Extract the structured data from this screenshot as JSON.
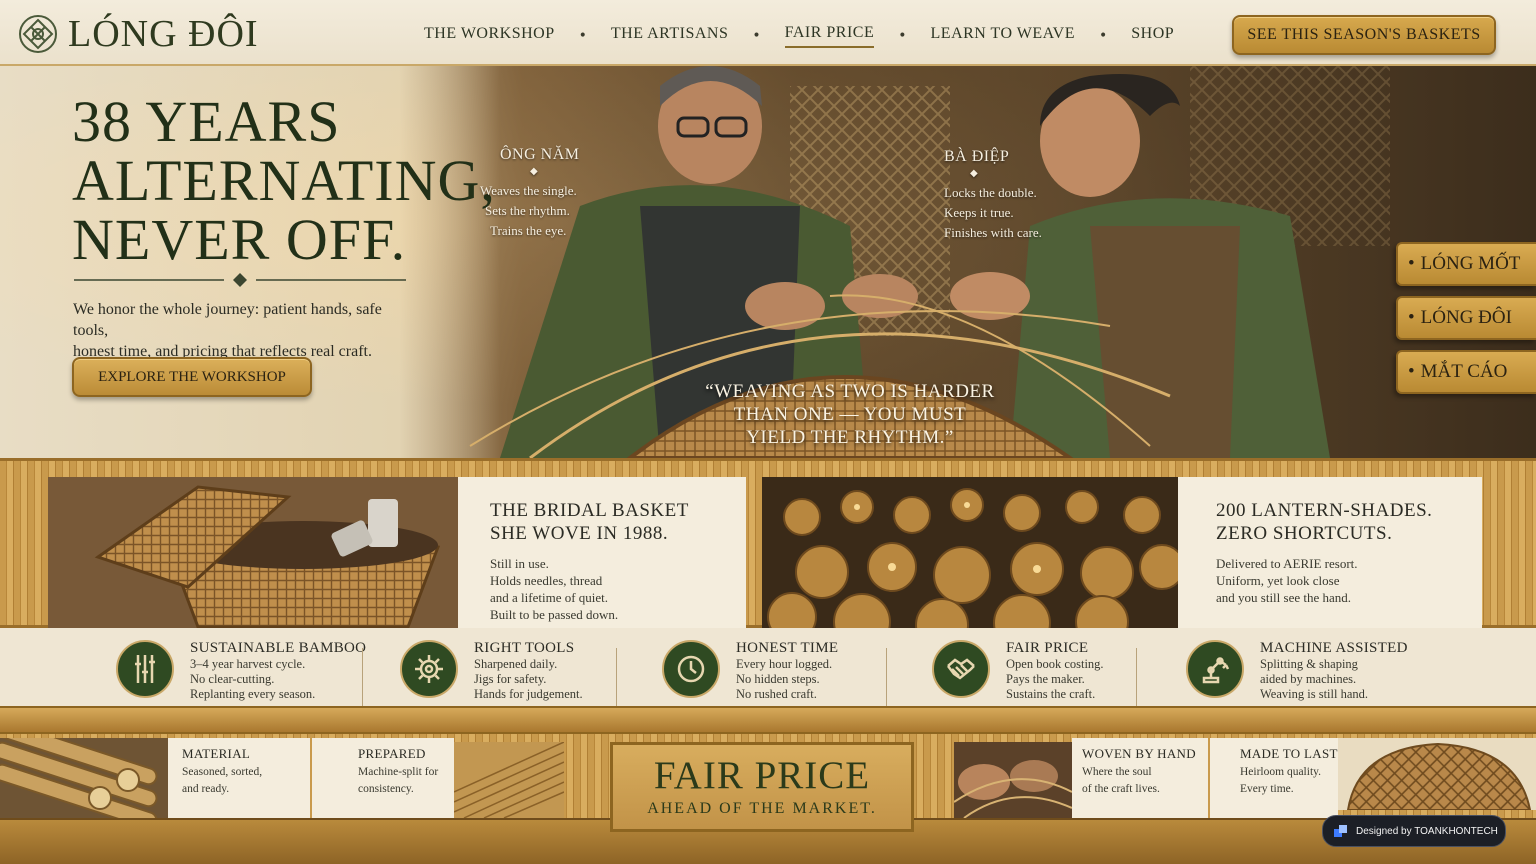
{
  "brand": {
    "name": "LÓNG ĐÔI",
    "logo_icon": "knot-emblem-icon"
  },
  "nav": {
    "items": [
      {
        "label": "THE WORKSHOP",
        "active": false
      },
      {
        "label": "THE ARTISANS",
        "active": false
      },
      {
        "label": "FAIR PRICE",
        "active": true
      },
      {
        "label": "LEARN TO WEAVE",
        "active": false
      },
      {
        "label": "SHOP",
        "active": false
      }
    ],
    "separator": "•",
    "cta": "SEE THIS SEASON'S BASKETS"
  },
  "hero": {
    "title_lines": [
      "38 YEARS",
      "ALTERNATING,",
      "NEVER OFF."
    ],
    "body_lines": [
      "We honor the whole journey: patient hands, safe tools,",
      "honest time, and pricing that reflects real craft."
    ],
    "cta": "EXPLORE THE WORKSHOP",
    "artisans": [
      {
        "name": "ÔNG NĂM",
        "lines": [
          "Weaves the single.",
          "Sets the rhythm.",
          "Trains the eye."
        ]
      },
      {
        "name": "BÀ ĐIỆP",
        "lines": [
          "Locks the double.",
          "Keeps it true.",
          "Finishes with care."
        ]
      }
    ],
    "quote_lines": [
      "“WEAVING AS TWO IS HARDER",
      "THAN ONE — YOU MUST",
      "YIELD THE RHYTHM.”"
    ],
    "side_tabs": [
      "LÓNG MỐT",
      "LÓNG ĐÔI",
      "MẮT CÁO"
    ]
  },
  "stories": [
    {
      "title_lines": [
        "THE BRIDAL BASKET",
        "SHE WOVE IN 1988."
      ],
      "body_lines": [
        "Still in use.",
        "Holds needles, thread",
        "and a lifetime of quiet.",
        "Built to be passed down."
      ]
    },
    {
      "title_lines": [
        "200 LANTERN-SHADES.",
        "ZERO SHORTCUTS."
      ],
      "body_lines": [
        "Delivered to AERIE resort.",
        "Uniform, yet look close",
        "and you still see the hand."
      ]
    }
  ],
  "values": [
    {
      "icon": "bamboo-icon",
      "title": "SUSTAINABLE BAMBOO",
      "lines": [
        "3–4 year harvest cycle.",
        "No clear-cutting.",
        "Replanting every season."
      ]
    },
    {
      "icon": "gear-icon",
      "title": "RIGHT TOOLS",
      "lines": [
        "Sharpened daily.",
        "Jigs for safety.",
        "Hands for judgement."
      ]
    },
    {
      "icon": "clock-icon",
      "title": "HONEST TIME",
      "lines": [
        "Every hour logged.",
        "No hidden steps.",
        "No rushed craft."
      ]
    },
    {
      "icon": "handshake-icon",
      "title": "FAIR PRICE",
      "lines": [
        "Open book costing.",
        "Pays the maker.",
        "Sustains the craft."
      ]
    },
    {
      "icon": "robot-arm-icon",
      "title": "MACHINE ASSISTED",
      "lines": [
        "Splitting & shaping",
        "aided by machines.",
        "Weaving is still hand."
      ]
    }
  ],
  "process": [
    {
      "title": "MATERIAL",
      "lines": [
        "Seasoned, sorted,",
        "and ready."
      ]
    },
    {
      "title": "PREPARED",
      "lines": [
        "Machine-split for",
        "consistency."
      ]
    },
    {
      "title": "WOVEN BY HAND",
      "lines": [
        "Where the soul",
        "of the craft lives."
      ]
    },
    {
      "title": "MADE TO LAST",
      "lines": [
        "Heirloom quality.",
        "Every time."
      ]
    }
  ],
  "fair_price": {
    "headline": "FAIR PRICE",
    "subline": "AHEAD OF THE MARKET."
  },
  "credit": "Designed by TOANKHONTECH",
  "colors": {
    "forest": "#2f4a22",
    "gold": "#c99a4c",
    "cream": "#f4eddd"
  }
}
